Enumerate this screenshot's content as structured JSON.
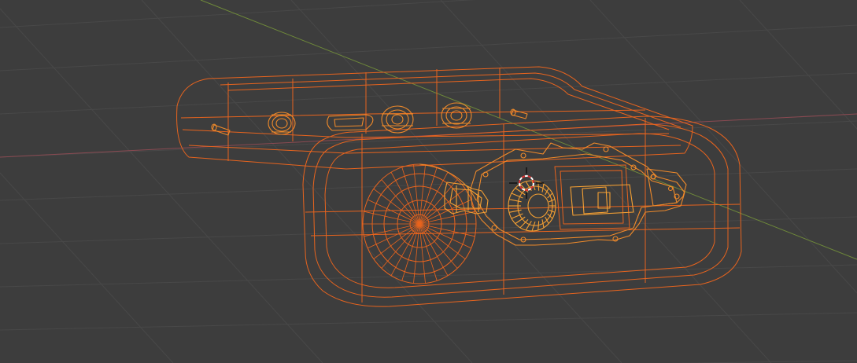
{
  "viewport": {
    "mode": "wireframe",
    "background": "#3d3d3d",
    "grid_color": "#484848",
    "x_axis_color": "#8a4a52",
    "y_axis_color": "#6f8a3a"
  },
  "selection": {
    "outline_color": "#e8641e",
    "inner_color": "#f08a2a",
    "active_color": "#f5a033"
  },
  "cursor": {
    "name": "3d-cursor",
    "ring_outer": "#ffffff",
    "ring_inner": "#e03030"
  },
  "objects": [
    {
      "name": "enclosure-body"
    },
    {
      "name": "drive-wheel"
    },
    {
      "name": "gearbox-plate"
    },
    {
      "name": "motor-gear"
    },
    {
      "name": "battery-holder"
    },
    {
      "name": "rear-knob-left"
    },
    {
      "name": "rear-knob-right"
    },
    {
      "name": "cylinder-connector"
    },
    {
      "name": "flat-button"
    }
  ]
}
